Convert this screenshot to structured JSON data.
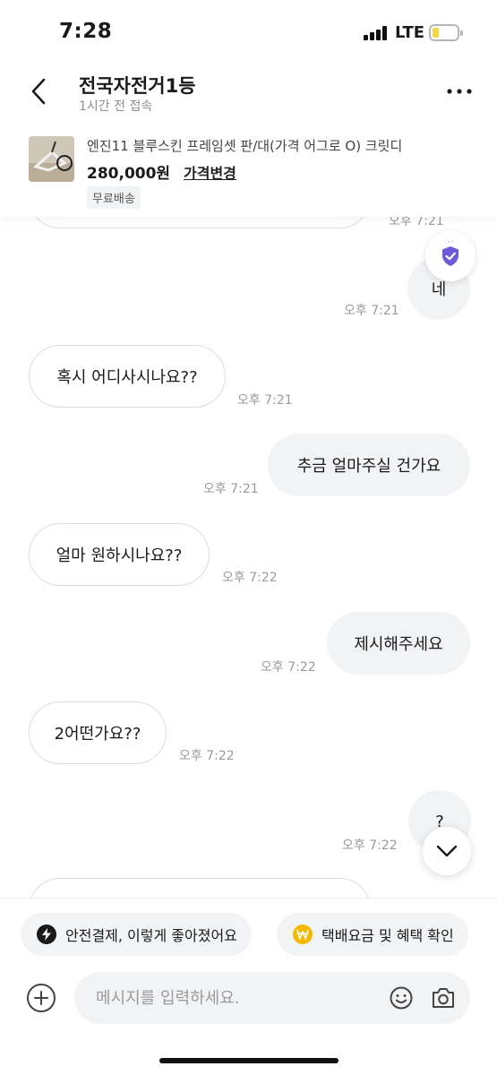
{
  "status_bar": {
    "time": "7:28",
    "network": "LTE"
  },
  "header": {
    "nickname": "전국자전거1등",
    "last_seen": "1시간 전 접속"
  },
  "product": {
    "title": "엔진11 블루스킨 프레임셋 판/대(가격 어그로 O) 크릿디",
    "price": "280,000원",
    "change_price": "가격변경",
    "shipping_badge": "무료배송"
  },
  "messages": [
    {
      "side": "in",
      "text": "",
      "time": "오후 7:21"
    },
    {
      "side": "out",
      "text": "네",
      "time": "오후 7:21"
    },
    {
      "side": "in",
      "text": "혹시 어디사시나요??",
      "time": "오후 7:21"
    },
    {
      "side": "out",
      "text": "추금 얼마주실 건가요",
      "time": "오후 7:21"
    },
    {
      "side": "in",
      "text": "얼마 원하시나요??",
      "time": "오후 7:22"
    },
    {
      "side": "out",
      "text": "제시해주세요",
      "time": "오후 7:22"
    },
    {
      "side": "in",
      "text": "2어떤가요??",
      "time": "오후 7:22"
    },
    {
      "side": "out",
      "text": "?",
      "time": "오후 7:22"
    },
    {
      "side": "in",
      "text": "",
      "time": ""
    }
  ],
  "chips": {
    "safe_pay": "안전결제, 이렇게 좋아졌어요",
    "delivery": "택배요금 및 혜택 확인"
  },
  "composer": {
    "placeholder": "메시지를 입력하세요."
  },
  "icons": {
    "back": "chevron-left-icon",
    "more": "more-horizontal-icon",
    "shield": "shield-check-icon",
    "scroll": "chevron-down-icon",
    "bolt": "lightning-icon",
    "won": "won-coin-icon",
    "plus": "plus-circle-icon",
    "emoji": "smiley-icon",
    "camera": "camera-icon"
  },
  "colors": {
    "shield_accent": "#6d5ad8",
    "coin": "#f5b800",
    "battery": "#f4d743"
  }
}
